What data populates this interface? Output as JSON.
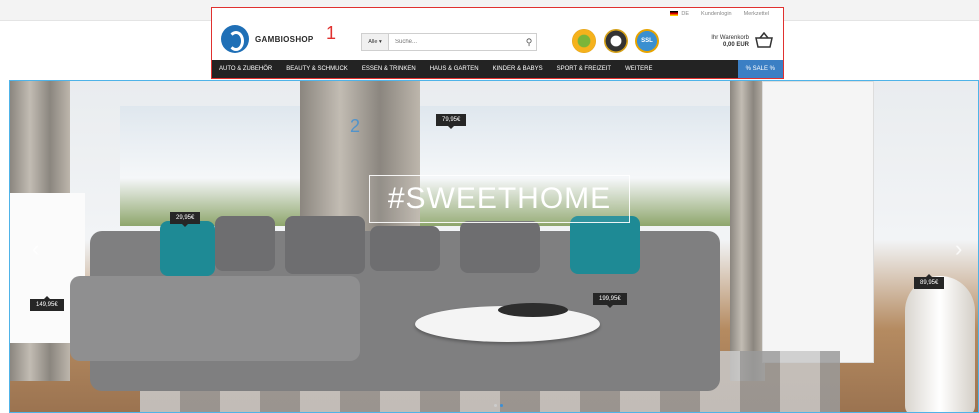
{
  "util": {
    "language": "DE",
    "login": "Kundenlogin",
    "notepad": "Merkzettel"
  },
  "logo": {
    "text": "GAMBIOSHOP"
  },
  "annotations": {
    "one": "1",
    "two": "2"
  },
  "search": {
    "category": "Alle ▾",
    "placeholder": "Suche..."
  },
  "trust": {
    "ssl": "SSL"
  },
  "cart": {
    "label": "Ihr Warenkorb",
    "total": "0,00 EUR"
  },
  "nav": {
    "items": [
      "AUTO & ZUBEHÖR",
      "BEAUTY & SCHMUCK",
      "ESSEN & TRINKEN",
      "HAUS & GARTEN",
      "KINDER & BABYS",
      "SPORT & FREIZEIT",
      "WEITERE"
    ],
    "sale": "% SALE %"
  },
  "hero": {
    "headline": "#SWEETHOME",
    "prices": {
      "p1": "79,95€",
      "p2": "29,95€",
      "p3": "149,95€",
      "p4": "199,95€",
      "p5": "89,95€"
    }
  },
  "colors": {
    "accent": "#3b7fc4",
    "annotation_red": "#e0312f",
    "nav_bg": "#232323"
  }
}
